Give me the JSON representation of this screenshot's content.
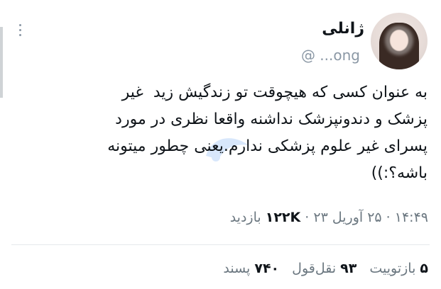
{
  "tweet": {
    "author": {
      "display_name": "ژانلی",
      "handle": "@ ...ong"
    },
    "text": "به عنوان کسی که هیچوقت تو زندگیش زید  غیر\nپزشک و دندونپزشک نداشنه واقعا نظری در مورد\nپسرای غیر علوم پزشکی ندارم.یعنی چطور میتونه\nباشه؟:))",
    "time": "۱۴:۴۹",
    "date": "۲۵ آوریل ۲۳",
    "views_count": "۱۲۲K",
    "views_label": "بازدید"
  },
  "stats": {
    "retweets_count": "۵",
    "retweets_label": "بازتوییت",
    "quotes_count": "۹۳",
    "quotes_label": "نقل‌قول",
    "likes_count": "۷۴۰",
    "likes_label": "پسند"
  }
}
